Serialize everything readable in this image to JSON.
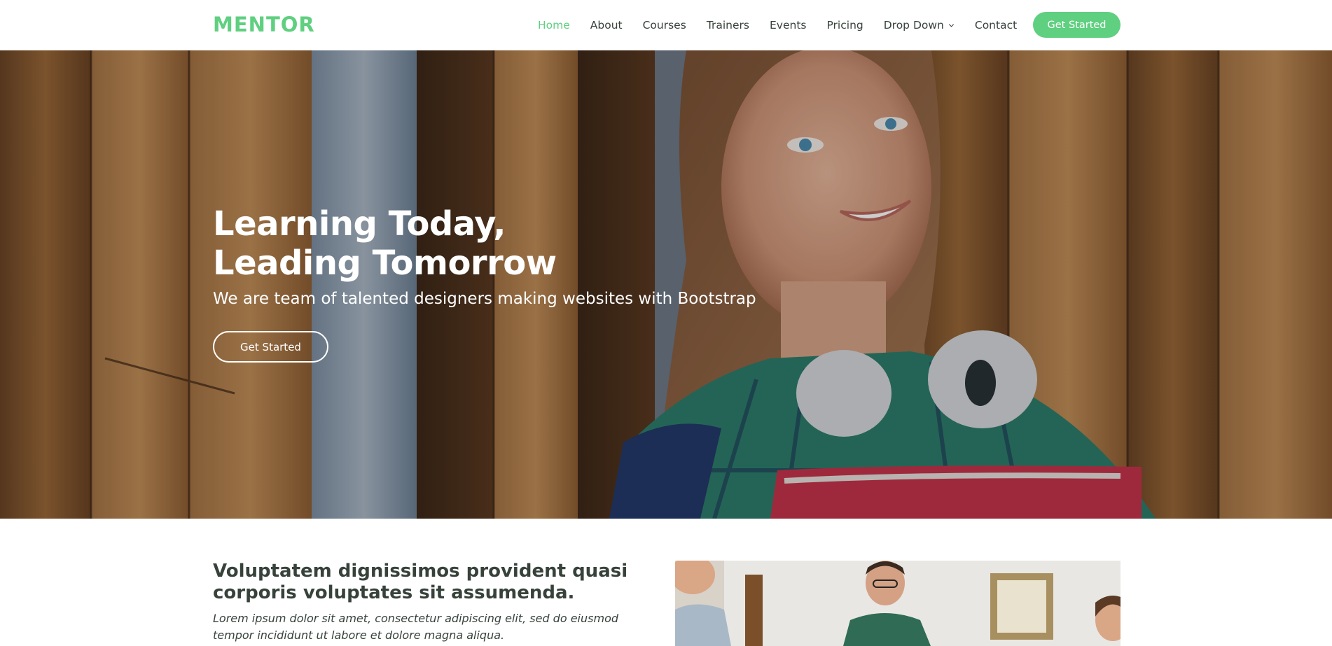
{
  "header": {
    "logo": "MENTOR",
    "nav": [
      {
        "label": "Home",
        "active": true
      },
      {
        "label": "About"
      },
      {
        "label": "Courses"
      },
      {
        "label": "Trainers"
      },
      {
        "label": "Events"
      },
      {
        "label": "Pricing"
      },
      {
        "label": "Drop Down",
        "has_dropdown": true
      },
      {
        "label": "Contact"
      }
    ],
    "cta_label": "Get Started"
  },
  "hero": {
    "title_line1": "Learning Today,",
    "title_line2": "Leading Tomorrow",
    "subtitle": "We are team of talented designers making websites with Bootstrap",
    "button_label": "Get Started"
  },
  "about": {
    "heading": "Voluptatem dignissimos provident quasi corporis voluptates sit assumenda.",
    "text": "Lorem ipsum dolor sit amet, consectetur adipiscing elit, sed do eiusmod tempor incididunt ut labore et dolore magna aliqua."
  },
  "colors": {
    "accent": "#5fcf80",
    "text": "#37423b",
    "white": "#ffffff"
  },
  "icons": {
    "dropdown": "chevron-down-icon"
  }
}
